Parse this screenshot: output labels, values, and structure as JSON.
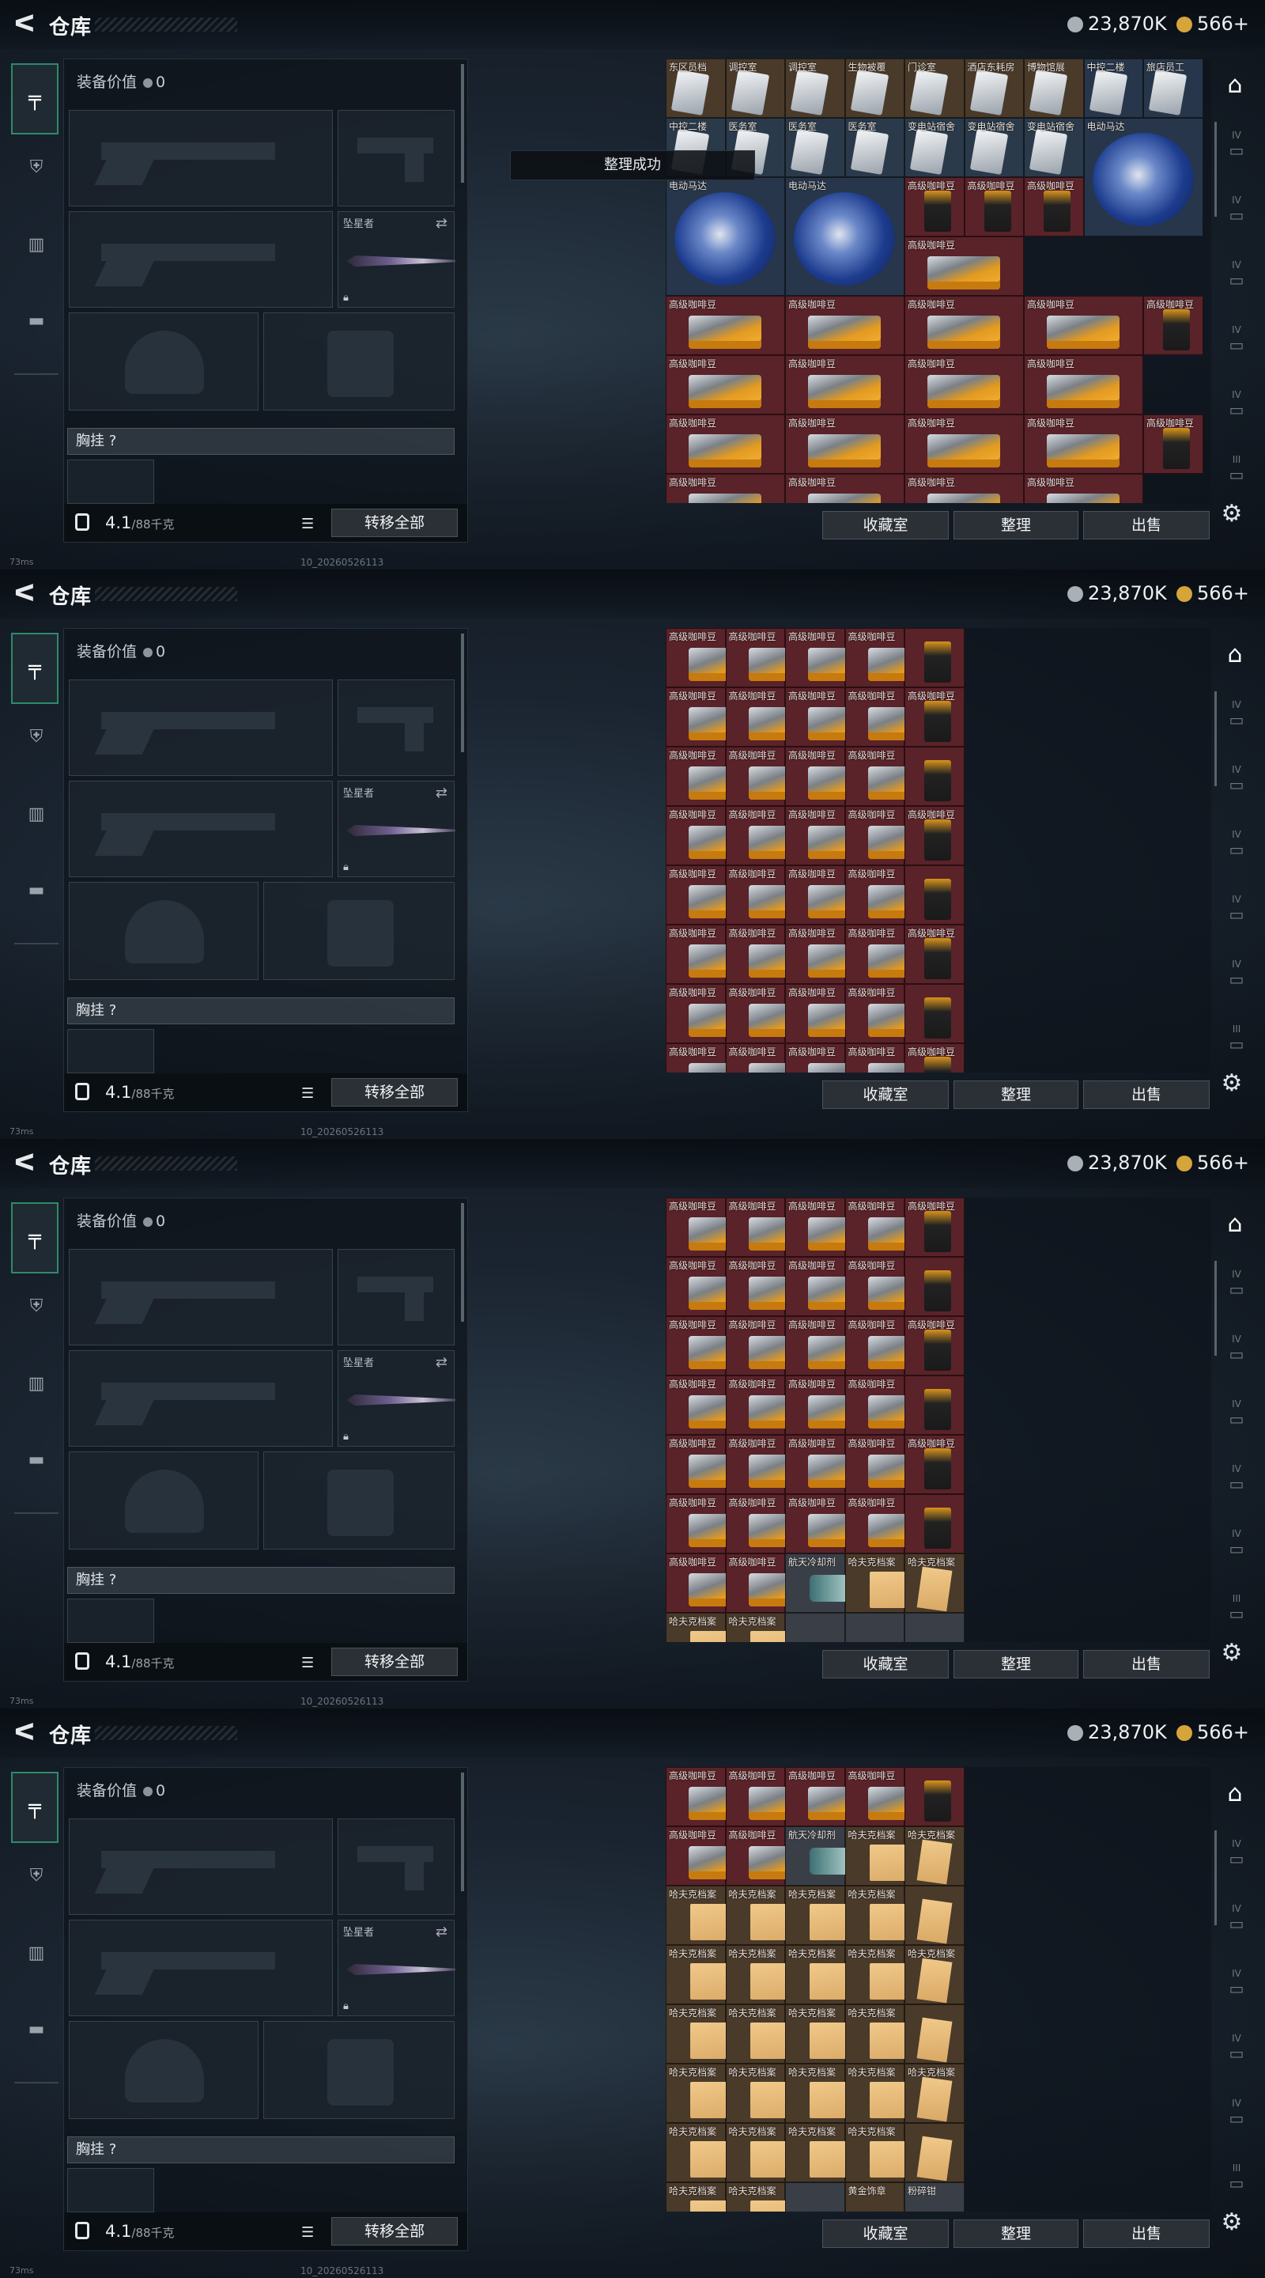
{
  "header": {
    "title": "仓库",
    "back_glyph": "ᐸ"
  },
  "currency": [
    {
      "value": "23,870K",
      "color": "#a9b0b6"
    },
    {
      "value": "566+",
      "color": "#d6a53a"
    }
  ],
  "equipment": {
    "value_label": "装备价值",
    "value": "0",
    "melee_name": "坠星者",
    "chest_label": "胸挂",
    "chest_help": "?",
    "weight": "4.1",
    "weight_cap": "/88千克",
    "transfer_all": "转移全部"
  },
  "stash_buttons": {
    "collection": "收藏室",
    "sort": "整理",
    "sell": "出售"
  },
  "toast": "整理成功",
  "status": {
    "ping": "73ms",
    "build": "10_20260526113"
  },
  "sidebar_tiers": [
    "IV",
    "IV",
    "IV",
    "IV",
    "IV",
    "III"
  ],
  "frames": [
    {
      "show_toast": true,
      "rows": [
        [
          {
            "n": "东区员档",
            "t": "card",
            "c": "c-brown"
          },
          {
            "n": "调控室",
            "t": "card",
            "c": "c-brown"
          },
          {
            "n": "调控室",
            "t": "card",
            "c": "c-brown"
          },
          {
            "n": "生物被覆",
            "t": "card",
            "c": "c-brown"
          },
          {
            "n": "门诊室",
            "t": "card",
            "c": "c-brown"
          },
          {
            "n": "酒店东耗房",
            "t": "card",
            "c": "c-brown"
          },
          {
            "n": "博物馆展",
            "t": "card",
            "c": "c-brown"
          },
          {
            "n": "中控二楼",
            "t": "card",
            "c": "c-blue"
          },
          {
            "n": "旅店员工",
            "t": "card",
            "c": "c-blue"
          }
        ],
        [
          {
            "n": "中控二楼",
            "t": "card",
            "c": "c-dk"
          },
          {
            "n": "医务室",
            "t": "card",
            "c": "c-dk"
          },
          {
            "n": "医务室",
            "t": "card",
            "c": "c-dk"
          },
          {
            "n": "医务室",
            "t": "card",
            "c": "c-dk"
          },
          {
            "n": "变电站宿舍",
            "t": "card",
            "c": "c-dk"
          },
          {
            "n": "变电站宿舍",
            "t": "card",
            "c": "c-dk"
          },
          {
            "n": "变电站宿舍",
            "t": "card",
            "c": "c-dk"
          },
          {
            "n": "电动马达",
            "t": "motor",
            "c": "c-blue",
            "w": 2,
            "h": 2
          }
        ],
        [
          {
            "n": "电动马达",
            "t": "motor",
            "c": "c-blue",
            "w": 2,
            "h": 2
          },
          {
            "n": "电动马达",
            "t": "motor",
            "c": "c-blue",
            "w": 2,
            "h": 2
          },
          {
            "n": "高级咖啡豆",
            "t": "bag",
            "c": "c-red"
          },
          {
            "n": "高级咖啡豆",
            "t": "bag",
            "c": "c-red"
          },
          {
            "n": "高级咖啡豆",
            "t": "bag",
            "c": "c-red"
          }
        ],
        [
          {
            "n": "高级咖啡豆",
            "t": "cof",
            "c": "c-red",
            "w": 2
          }
        ],
        [
          {
            "n": "高级咖啡豆",
            "t": "cof",
            "c": "c-red",
            "w": 2
          },
          {
            "n": "高级咖啡豆",
            "t": "cof",
            "c": "c-red",
            "w": 2
          },
          {
            "n": "高级咖啡豆",
            "t": "cof",
            "c": "c-red",
            "w": 2
          },
          {
            "n": "高级咖啡豆",
            "t": "cof",
            "c": "c-red",
            "w": 2
          },
          {
            "n": "高级咖啡豆",
            "t": "bag",
            "c": "c-red"
          }
        ],
        [
          {
            "n": "高级咖啡豆",
            "t": "cof",
            "c": "c-red",
            "w": 2
          },
          {
            "n": "高级咖啡豆",
            "t": "cof",
            "c": "c-red",
            "w": 2
          },
          {
            "n": "高级咖啡豆",
            "t": "cof",
            "c": "c-red",
            "w": 2
          },
          {
            "n": "高级咖啡豆",
            "t": "cof",
            "c": "c-red",
            "w": 2
          }
        ],
        [
          {
            "n": "高级咖啡豆",
            "t": "cof",
            "c": "c-red",
            "w": 2
          },
          {
            "n": "高级咖啡豆",
            "t": "cof",
            "c": "c-red",
            "w": 2
          },
          {
            "n": "高级咖啡豆",
            "t": "cof",
            "c": "c-red",
            "w": 2
          },
          {
            "n": "高级咖啡豆",
            "t": "cof",
            "c": "c-red",
            "w": 2
          },
          {
            "n": "高级咖啡豆",
            "t": "bag",
            "c": "c-red"
          }
        ],
        [
          {
            "n": "高级咖啡豆",
            "t": "cof",
            "c": "c-red",
            "w": 2
          },
          {
            "n": "高级咖啡豆",
            "t": "cof",
            "c": "c-red",
            "w": 2
          },
          {
            "n": "高级咖啡豆",
            "t": "cof",
            "c": "c-red",
            "w": 2
          },
          {
            "n": "高级咖啡豆",
            "t": "cof",
            "c": "c-red",
            "w": 2
          }
        ]
      ]
    },
    {
      "show_toast": false,
      "rows": [
        [
          {
            "n": "高级咖啡豆",
            "t": "cof",
            "c": "c-red"
          },
          {
            "n": "高级咖啡豆",
            "t": "cof",
            "c": "c-red"
          },
          {
            "n": "高级咖啡豆",
            "t": "cof",
            "c": "c-red"
          },
          {
            "n": "高级咖啡豆",
            "t": "cof",
            "c": "c-red"
          },
          {
            "n": "",
            "t": "bag",
            "c": "c-red"
          }
        ],
        [
          {
            "n": "高级咖啡豆",
            "t": "cof",
            "c": "c-red"
          },
          {
            "n": "高级咖啡豆",
            "t": "cof",
            "c": "c-red"
          },
          {
            "n": "高级咖啡豆",
            "t": "cof",
            "c": "c-red"
          },
          {
            "n": "高级咖啡豆",
            "t": "cof",
            "c": "c-red"
          },
          {
            "n": "高级咖啡豆",
            "t": "bag",
            "c": "c-red"
          }
        ],
        [
          {
            "n": "高级咖啡豆",
            "t": "cof",
            "c": "c-red"
          },
          {
            "n": "高级咖啡豆",
            "t": "cof",
            "c": "c-red"
          },
          {
            "n": "高级咖啡豆",
            "t": "cof",
            "c": "c-red"
          },
          {
            "n": "高级咖啡豆",
            "t": "cof",
            "c": "c-red"
          },
          {
            "n": "",
            "t": "bag",
            "c": "c-red"
          }
        ],
        [
          {
            "n": "高级咖啡豆",
            "t": "cof",
            "c": "c-red"
          },
          {
            "n": "高级咖啡豆",
            "t": "cof",
            "c": "c-red"
          },
          {
            "n": "高级咖啡豆",
            "t": "cof",
            "c": "c-red"
          },
          {
            "n": "高级咖啡豆",
            "t": "cof",
            "c": "c-red"
          },
          {
            "n": "高级咖啡豆",
            "t": "bag",
            "c": "c-red"
          }
        ],
        [
          {
            "n": "高级咖啡豆",
            "t": "cof",
            "c": "c-red"
          },
          {
            "n": "高级咖啡豆",
            "t": "cof",
            "c": "c-red"
          },
          {
            "n": "高级咖啡豆",
            "t": "cof",
            "c": "c-red"
          },
          {
            "n": "高级咖啡豆",
            "t": "cof",
            "c": "c-red"
          },
          {
            "n": "",
            "t": "bag",
            "c": "c-red"
          }
        ],
        [
          {
            "n": "高级咖啡豆",
            "t": "cof",
            "c": "c-red"
          },
          {
            "n": "高级咖啡豆",
            "t": "cof",
            "c": "c-red"
          },
          {
            "n": "高级咖啡豆",
            "t": "cof",
            "c": "c-red"
          },
          {
            "n": "高级咖啡豆",
            "t": "cof",
            "c": "c-red"
          },
          {
            "n": "高级咖啡豆",
            "t": "bag",
            "c": "c-red"
          }
        ],
        [
          {
            "n": "高级咖啡豆",
            "t": "cof",
            "c": "c-red"
          },
          {
            "n": "高级咖啡豆",
            "t": "cof",
            "c": "c-red"
          },
          {
            "n": "高级咖啡豆",
            "t": "cof",
            "c": "c-red"
          },
          {
            "n": "高级咖啡豆",
            "t": "cof",
            "c": "c-red"
          },
          {
            "n": "",
            "t": "bag",
            "c": "c-red"
          }
        ],
        [
          {
            "n": "高级咖啡豆",
            "t": "cof",
            "c": "c-red"
          },
          {
            "n": "高级咖啡豆",
            "t": "cof",
            "c": "c-red"
          },
          {
            "n": "高级咖啡豆",
            "t": "cof",
            "c": "c-red"
          },
          {
            "n": "高级咖啡豆",
            "t": "cof",
            "c": "c-red"
          },
          {
            "n": "高级咖啡豆",
            "t": "bag",
            "c": "c-red"
          }
        ]
      ]
    },
    {
      "show_toast": false,
      "rows": [
        [
          {
            "n": "高级咖啡豆",
            "t": "cof",
            "c": "c-red"
          },
          {
            "n": "高级咖啡豆",
            "t": "cof",
            "c": "c-red"
          },
          {
            "n": "高级咖啡豆",
            "t": "cof",
            "c": "c-red"
          },
          {
            "n": "高级咖啡豆",
            "t": "cof",
            "c": "c-red"
          },
          {
            "n": "高级咖啡豆",
            "t": "bag",
            "c": "c-red"
          }
        ],
        [
          {
            "n": "高级咖啡豆",
            "t": "cof",
            "c": "c-red"
          },
          {
            "n": "高级咖啡豆",
            "t": "cof",
            "c": "c-red"
          },
          {
            "n": "高级咖啡豆",
            "t": "cof",
            "c": "c-red"
          },
          {
            "n": "高级咖啡豆",
            "t": "cof",
            "c": "c-red"
          },
          {
            "n": "",
            "t": "bag",
            "c": "c-red"
          }
        ],
        [
          {
            "n": "高级咖啡豆",
            "t": "cof",
            "c": "c-red"
          },
          {
            "n": "高级咖啡豆",
            "t": "cof",
            "c": "c-red"
          },
          {
            "n": "高级咖啡豆",
            "t": "cof",
            "c": "c-red"
          },
          {
            "n": "高级咖啡豆",
            "t": "cof",
            "c": "c-red"
          },
          {
            "n": "高级咖啡豆",
            "t": "bag",
            "c": "c-red"
          }
        ],
        [
          {
            "n": "高级咖啡豆",
            "t": "cof",
            "c": "c-red"
          },
          {
            "n": "高级咖啡豆",
            "t": "cof",
            "c": "c-red"
          },
          {
            "n": "高级咖啡豆",
            "t": "cof",
            "c": "c-red"
          },
          {
            "n": "高级咖啡豆",
            "t": "cof",
            "c": "c-red"
          },
          {
            "n": "",
            "t": "bag",
            "c": "c-red"
          }
        ],
        [
          {
            "n": "高级咖啡豆",
            "t": "cof",
            "c": "c-red"
          },
          {
            "n": "高级咖啡豆",
            "t": "cof",
            "c": "c-red"
          },
          {
            "n": "高级咖啡豆",
            "t": "cof",
            "c": "c-red"
          },
          {
            "n": "高级咖啡豆",
            "t": "cof",
            "c": "c-red"
          },
          {
            "n": "高级咖啡豆",
            "t": "bag",
            "c": "c-red"
          }
        ],
        [
          {
            "n": "高级咖啡豆",
            "t": "cof",
            "c": "c-red"
          },
          {
            "n": "高级咖啡豆",
            "t": "cof",
            "c": "c-red"
          },
          {
            "n": "高级咖啡豆",
            "t": "cof",
            "c": "c-red"
          },
          {
            "n": "高级咖啡豆",
            "t": "cof",
            "c": "c-red"
          },
          {
            "n": "",
            "t": "bag",
            "c": "c-red"
          }
        ],
        [
          {
            "n": "高级咖啡豆",
            "t": "cof",
            "c": "c-red"
          },
          {
            "n": "高级咖啡豆",
            "t": "cof",
            "c": "c-red"
          },
          {
            "n": "航天冷却剂",
            "t": "cool",
            "c": "c-grey"
          },
          {
            "n": "哈夫克档案",
            "t": "file",
            "c": "c-brown"
          },
          {
            "n": "哈夫克档案",
            "t": "filev",
            "c": "c-brown"
          }
        ],
        [
          {
            "n": "哈夫克档案",
            "t": "file",
            "c": "c-brown"
          },
          {
            "n": "哈夫克档案",
            "t": "file",
            "c": "c-brown"
          },
          {
            "n": "",
            "t": "none",
            "c": "c-grey"
          },
          {
            "n": "",
            "t": "none",
            "c": "c-grey"
          },
          {
            "n": "",
            "t": "none",
            "c": "c-grey"
          }
        ]
      ]
    },
    {
      "show_toast": false,
      "rows": [
        [
          {
            "n": "高级咖啡豆",
            "t": "cof",
            "c": "c-red"
          },
          {
            "n": "高级咖啡豆",
            "t": "cof",
            "c": "c-red"
          },
          {
            "n": "高级咖啡豆",
            "t": "cof",
            "c": "c-red"
          },
          {
            "n": "高级咖啡豆",
            "t": "cof",
            "c": "c-red"
          },
          {
            "n": "",
            "t": "bag",
            "c": "c-red"
          }
        ],
        [
          {
            "n": "高级咖啡豆",
            "t": "cof",
            "c": "c-red"
          },
          {
            "n": "高级咖啡豆",
            "t": "cof",
            "c": "c-red"
          },
          {
            "n": "航天冷却剂",
            "t": "cool",
            "c": "c-grey"
          },
          {
            "n": "哈夫克档案",
            "t": "file",
            "c": "c-brown"
          },
          {
            "n": "哈夫克档案",
            "t": "filev",
            "c": "c-brown"
          }
        ],
        [
          {
            "n": "哈夫克档案",
            "t": "file",
            "c": "c-brown"
          },
          {
            "n": "哈夫克档案",
            "t": "file",
            "c": "c-brown"
          },
          {
            "n": "哈夫克档案",
            "t": "file",
            "c": "c-brown"
          },
          {
            "n": "哈夫克档案",
            "t": "file",
            "c": "c-brown"
          },
          {
            "n": "",
            "t": "filev",
            "c": "c-brown"
          }
        ],
        [
          {
            "n": "哈夫克档案",
            "t": "file",
            "c": "c-brown"
          },
          {
            "n": "哈夫克档案",
            "t": "file",
            "c": "c-brown"
          },
          {
            "n": "哈夫克档案",
            "t": "file",
            "c": "c-brown"
          },
          {
            "n": "哈夫克档案",
            "t": "file",
            "c": "c-brown"
          },
          {
            "n": "哈夫克档案",
            "t": "filev",
            "c": "c-brown"
          }
        ],
        [
          {
            "n": "哈夫克档案",
            "t": "file",
            "c": "c-brown"
          },
          {
            "n": "哈夫克档案",
            "t": "file",
            "c": "c-brown"
          },
          {
            "n": "哈夫克档案",
            "t": "file",
            "c": "c-brown"
          },
          {
            "n": "哈夫克档案",
            "t": "file",
            "c": "c-brown"
          },
          {
            "n": "",
            "t": "filev",
            "c": "c-brown"
          }
        ],
        [
          {
            "n": "哈夫克档案",
            "t": "file",
            "c": "c-brown"
          },
          {
            "n": "哈夫克档案",
            "t": "file",
            "c": "c-brown"
          },
          {
            "n": "哈夫克档案",
            "t": "file",
            "c": "c-brown"
          },
          {
            "n": "哈夫克档案",
            "t": "file",
            "c": "c-brown"
          },
          {
            "n": "哈夫克档案",
            "t": "filev",
            "c": "c-brown"
          }
        ],
        [
          {
            "n": "哈夫克档案",
            "t": "file",
            "c": "c-brown"
          },
          {
            "n": "哈夫克档案",
            "t": "file",
            "c": "c-brown"
          },
          {
            "n": "哈夫克档案",
            "t": "file",
            "c": "c-brown"
          },
          {
            "n": "哈夫克档案",
            "t": "file",
            "c": "c-brown"
          },
          {
            "n": "",
            "t": "filev",
            "c": "c-brown"
          }
        ],
        [
          {
            "n": "哈夫克档案",
            "t": "file",
            "c": "c-brown"
          },
          {
            "n": "哈夫克档案",
            "t": "file",
            "c": "c-brown"
          },
          {
            "n": "",
            "t": "none",
            "c": "c-grey"
          },
          {
            "n": "黄金饰章",
            "t": "gold",
            "c": "c-brown"
          },
          {
            "n": "粉碎钳",
            "t": "none",
            "c": "c-grey"
          }
        ]
      ]
    }
  ]
}
